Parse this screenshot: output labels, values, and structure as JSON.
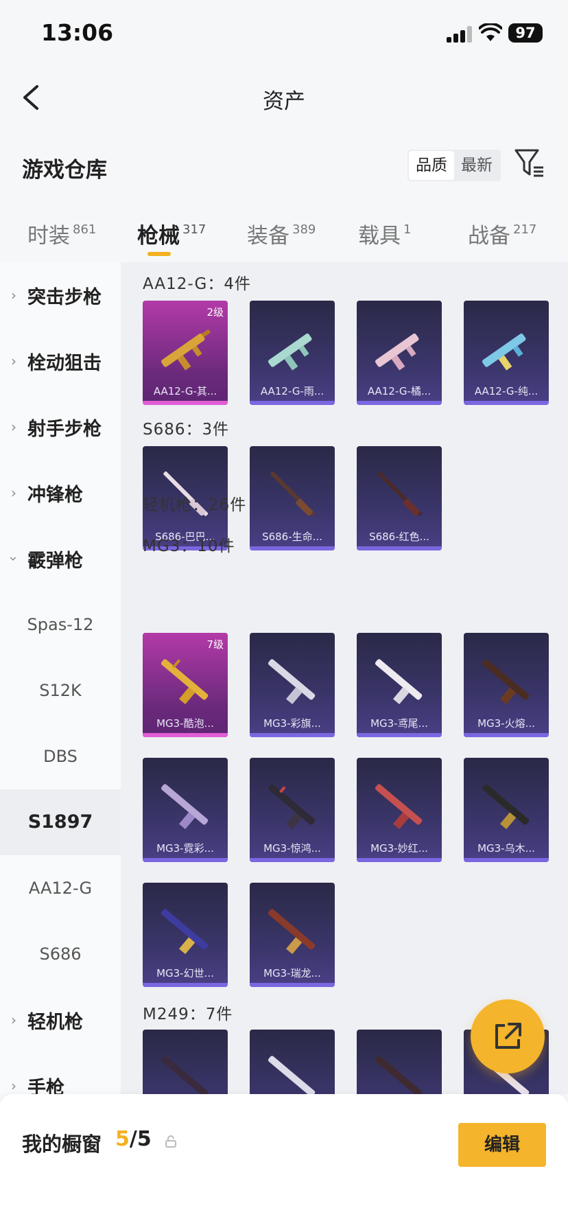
{
  "status_bar": {
    "time": "13:06",
    "battery": "97"
  },
  "header": {
    "title": "资产"
  },
  "section": {
    "title": "游戏仓库",
    "sort_options": [
      "品质",
      "最新"
    ]
  },
  "tabs": [
    {
      "label": "时装",
      "count": "861"
    },
    {
      "label": "枪械",
      "count": "317"
    },
    {
      "label": "装备",
      "count": "389"
    },
    {
      "label": "载具",
      "count": "1"
    },
    {
      "label": "战备",
      "count": "217"
    }
  ],
  "sidebar": {
    "categories": [
      "突击步枪",
      "栓动狙击",
      "射手步枪",
      "冲锋枪",
      "霰弹枪"
    ],
    "sub_items": [
      "Spas-12",
      "S12K",
      "DBS",
      "S1897",
      "AA12-G",
      "S686"
    ],
    "categories_after": [
      "轻机枪",
      "手枪"
    ]
  },
  "groups": [
    {
      "title": "AA12-G：4件",
      "items": [
        {
          "name": "AA12-G-其...",
          "level": "2级"
        },
        {
          "name": "AA12-G-雨..."
        },
        {
          "name": "AA12-G-橘..."
        },
        {
          "name": "AA12-G-纯..."
        }
      ]
    },
    {
      "title": "S686：3件",
      "items": [
        {
          "name": "S686-巴巴..."
        },
        {
          "name": "S686-生命..."
        },
        {
          "name": "S686-红色..."
        }
      ]
    },
    {
      "title": "轻机枪：26件"
    },
    {
      "title": "MG3：10件",
      "items": [
        {
          "name": "MG3-酷泡...",
          "level": "7级"
        },
        {
          "name": "MG3-彩旗..."
        },
        {
          "name": "MG3-鸢尾..."
        },
        {
          "name": "MG3-火熔..."
        },
        {
          "name": "MG3-霓彩..."
        },
        {
          "name": "MG3-惊鸿..."
        },
        {
          "name": "MG3-妙红..."
        },
        {
          "name": "MG3-乌木..."
        },
        {
          "name": "MG3-幻世..."
        },
        {
          "name": "MG3-瑞龙..."
        }
      ]
    },
    {
      "title": "M249：7件"
    }
  ],
  "bottom": {
    "showcase_label": "我的橱窗",
    "showcase_current": "5",
    "showcase_total": "/5",
    "edit_label": "编辑"
  },
  "colors": {
    "accent": "#f4b42b",
    "card_purple": "#3a3569",
    "card_gold": "#b23aa8"
  }
}
